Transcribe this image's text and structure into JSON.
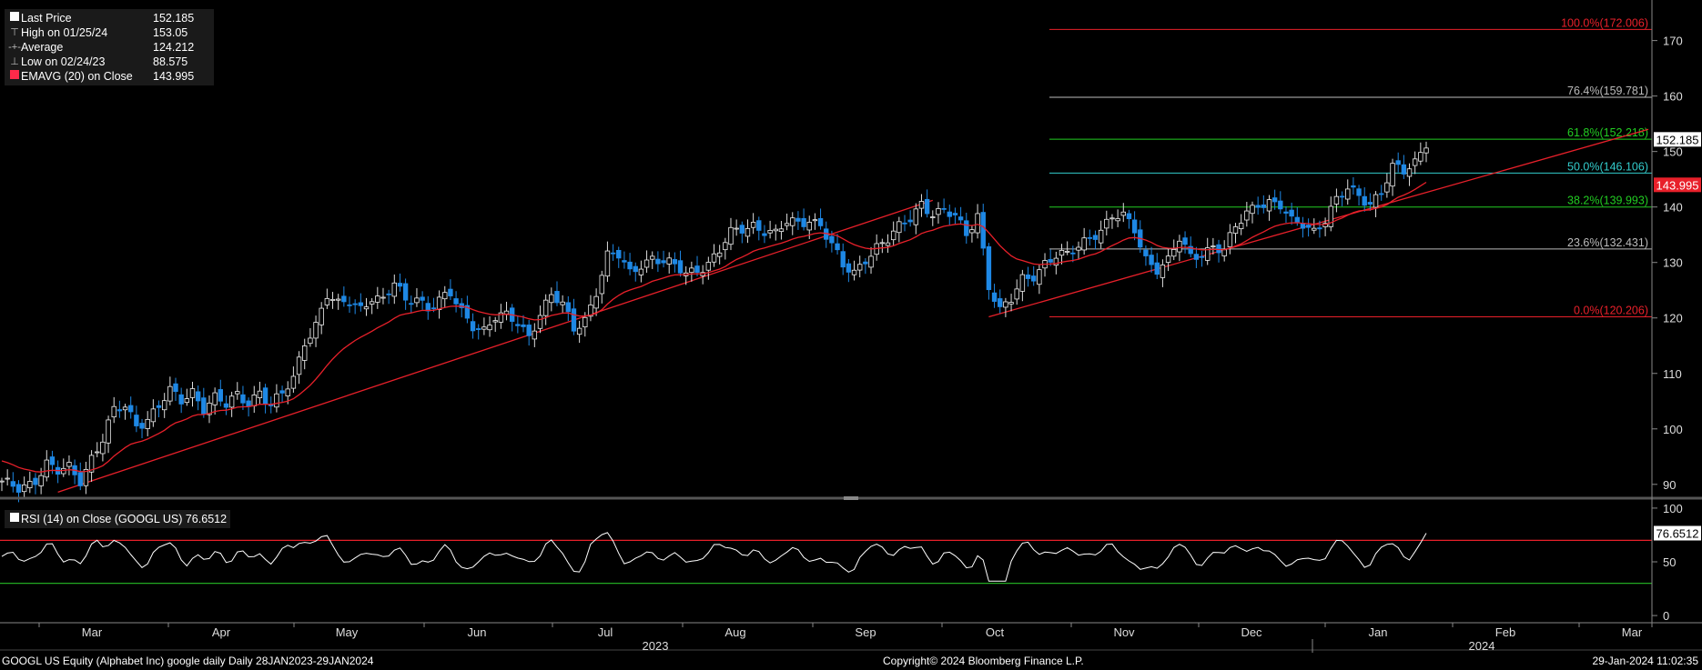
{
  "legend_main": {
    "last_price_label": "Last Price",
    "last_price": "152.185",
    "high_label": "High on 01/25/24",
    "high": "153.05",
    "average_label": "Average",
    "average": "124.212",
    "low_label": "Low on 02/24/23",
    "low": "88.575",
    "ema_label": "EMAVG (20)  on Close",
    "ema": "143.995"
  },
  "legend_rsi": {
    "label": "RSI (14)  on Close (GOOGL US)",
    "value": "76.6512"
  },
  "footer": {
    "left": "GOOGL US Equity (Alphabet Inc) google daily  Daily 28JAN2023-29JAN2024",
    "center": "Copyright© 2024 Bloomberg Finance L.P.",
    "right": "29-Jan-2024 11:02:35"
  },
  "colors": {
    "up_candle": "#ffffff",
    "down_candle": "#1e88e5",
    "ema": "#e8202a",
    "trendline": "#e8202a",
    "rsi_line": "#ffffff",
    "rsi_upper": "#e8202a",
    "rsi_lower": "#22aa22"
  },
  "chart_data": {
    "type": "candlestick",
    "x_axis": {
      "months": [
        "Mar",
        "Apr",
        "May",
        "Jun",
        "Jul",
        "Aug",
        "Sep",
        "Oct",
        "Nov",
        "Dec",
        "Jan",
        "Feb",
        "Mar"
      ],
      "years": [
        "2023",
        "2024"
      ]
    },
    "price_axis": {
      "ylim": [
        88,
        176
      ],
      "ticks": [
        90,
        100,
        110,
        120,
        130,
        140,
        150,
        160,
        170
      ]
    },
    "rsi_axis": {
      "ylim": [
        -5,
        105
      ],
      "ticks": [
        0,
        50,
        100
      ],
      "upper": 70,
      "lower": 30
    },
    "fibonacci": [
      {
        "label": "100.0%(172.006)",
        "value": 172.006,
        "color": "#e8202a"
      },
      {
        "label": "76.4%(159.781)",
        "value": 159.781,
        "color": "#bbbbbb"
      },
      {
        "label": "61.8%(152.218)",
        "value": 152.218,
        "color": "#22cc22"
      },
      {
        "label": "50.0%(146.106)",
        "value": 146.106,
        "color": "#33cccc"
      },
      {
        "label": "38.2%(139.993)",
        "value": 139.993,
        "color": "#22cc22"
      },
      {
        "label": "23.6%(132.431)",
        "value": 132.431,
        "color": "#bbbbbb"
      },
      {
        "label": "0.0%(120.206)",
        "value": 120.206,
        "color": "#e8202a"
      }
    ],
    "price_badges": [
      {
        "label": "152.185",
        "value": 152.185,
        "bg": "#ffffff",
        "fg": "#000000"
      },
      {
        "label": "143.995",
        "value": 143.995,
        "bg": "#e8202a",
        "fg": "#ffffff"
      }
    ],
    "rsi_badge": {
      "label": "76.6512",
      "value": 76.65
    },
    "price_anchors": [
      [
        0,
        90
      ],
      [
        3,
        89.5
      ],
      [
        6,
        91
      ],
      [
        8,
        93.5
      ],
      [
        10,
        92
      ],
      [
        12,
        93
      ],
      [
        14,
        91
      ],
      [
        16,
        95
      ],
      [
        18,
        98
      ],
      [
        20,
        103
      ],
      [
        22,
        104
      ],
      [
        24,
        101
      ],
      [
        26,
        102
      ],
      [
        28,
        104
      ],
      [
        30,
        106.5
      ],
      [
        32,
        105
      ],
      [
        34,
        107
      ],
      [
        36,
        104
      ],
      [
        38,
        105.5
      ],
      [
        40,
        104
      ],
      [
        42,
        106
      ],
      [
        44,
        105
      ],
      [
        46,
        107
      ],
      [
        48,
        104
      ],
      [
        50,
        106
      ],
      [
        52,
        109
      ],
      [
        54,
        116
      ],
      [
        56,
        119
      ],
      [
        58,
        124
      ],
      [
        60,
        122
      ],
      [
        62,
        123
      ],
      [
        64,
        122
      ],
      [
        66,
        124
      ],
      [
        68,
        123
      ],
      [
        70,
        126
      ],
      [
        72,
        123
      ],
      [
        74,
        124
      ],
      [
        76,
        122
      ],
      [
        78,
        123
      ],
      [
        80,
        124
      ],
      [
        82,
        121
      ],
      [
        84,
        119
      ],
      [
        86,
        118
      ],
      [
        88,
        120
      ],
      [
        90,
        120
      ],
      [
        92,
        119
      ],
      [
        94,
        117
      ],
      [
        96,
        121
      ],
      [
        98,
        124
      ],
      [
        100,
        122
      ],
      [
        102,
        118
      ],
      [
        104,
        120
      ],
      [
        106,
        125
      ],
      [
        108,
        131
      ],
      [
        110,
        131
      ],
      [
        112,
        128
      ],
      [
        114,
        130
      ],
      [
        116,
        131
      ],
      [
        118,
        130
      ],
      [
        120,
        129
      ],
      [
        122,
        128
      ],
      [
        124,
        129
      ],
      [
        126,
        130
      ],
      [
        128,
        132
      ],
      [
        130,
        135
      ],
      [
        132,
        136
      ],
      [
        134,
        137
      ],
      [
        136,
        136
      ],
      [
        138,
        135
      ],
      [
        140,
        137
      ],
      [
        142,
        137
      ],
      [
        144,
        138
      ],
      [
        146,
        137
      ],
      [
        148,
        133
      ],
      [
        150,
        129
      ],
      [
        152,
        128
      ],
      [
        154,
        131
      ],
      [
        156,
        133
      ],
      [
        158,
        134
      ],
      [
        160,
        136
      ],
      [
        162,
        138
      ],
      [
        164,
        141
      ],
      [
        166,
        139
      ],
      [
        168,
        139
      ],
      [
        170,
        138
      ],
      [
        172,
        135
      ],
      [
        174,
        139
      ],
      [
        176,
        126
      ],
      [
        178,
        121
      ],
      [
        180,
        123
      ],
      [
        182,
        127
      ],
      [
        184,
        128
      ],
      [
        186,
        130
      ],
      [
        188,
        131
      ],
      [
        190,
        131
      ],
      [
        192,
        133
      ],
      [
        194,
        135
      ],
      [
        196,
        136
      ],
      [
        198,
        138
      ],
      [
        200,
        138
      ],
      [
        202,
        136
      ],
      [
        204,
        131
      ],
      [
        206,
        129
      ],
      [
        208,
        130
      ],
      [
        210,
        134
      ],
      [
        212,
        131
      ],
      [
        214,
        132
      ],
      [
        216,
        133
      ],
      [
        218,
        132
      ],
      [
        220,
        136
      ],
      [
        222,
        139
      ],
      [
        224,
        141
      ],
      [
        226,
        141
      ],
      [
        228,
        140
      ],
      [
        230,
        137
      ],
      [
        232,
        137
      ],
      [
        234,
        136
      ],
      [
        236,
        138
      ],
      [
        238,
        141
      ],
      [
        240,
        143
      ],
      [
        242,
        142
      ],
      [
        244,
        141
      ],
      [
        246,
        143
      ],
      [
        248,
        147
      ],
      [
        250,
        146
      ],
      [
        252,
        148
      ],
      [
        254,
        152
      ]
    ],
    "n_bars": 255
  }
}
